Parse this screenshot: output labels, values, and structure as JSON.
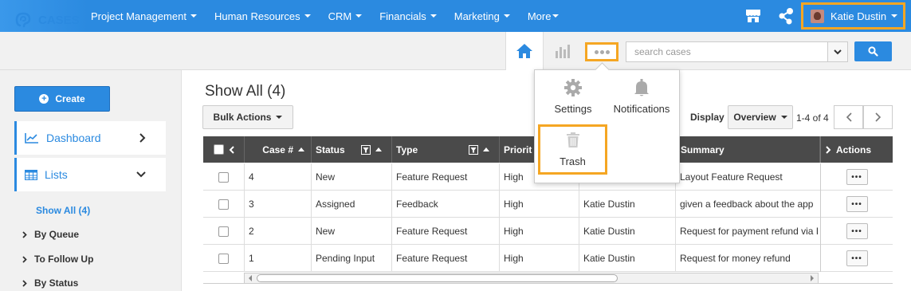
{
  "topnav": {
    "items": [
      "Project Management",
      "Human Resources",
      "CRM",
      "Financials",
      "Marketing",
      "More"
    ],
    "user_name": "Katie Dustin"
  },
  "module": {
    "title": "CASES",
    "search_placeholder": "search cases"
  },
  "more_menu": {
    "items": [
      "Settings",
      "Notifications",
      "Trash"
    ]
  },
  "sidebar": {
    "create_label": "Create",
    "dashboard_label": "Dashboard",
    "lists_label": "Lists",
    "show_all_label": "Show All (4)",
    "sub_items": [
      "By Queue",
      "To Follow Up",
      "By Status"
    ]
  },
  "main": {
    "title": "Show All (4)",
    "bulk_actions_label": "Bulk Actions",
    "display_label": "Display",
    "display_value": "Overview",
    "pager_text": "1-4 of 4"
  },
  "table": {
    "headers": [
      "Case #",
      "Status",
      "Type",
      "Priorit",
      "Summary",
      "Actions"
    ],
    "rows": [
      {
        "case": "4",
        "status": "New",
        "type": "Feature Request",
        "priority": "High",
        "assigned": "",
        "summary": "Layout Feature Request"
      },
      {
        "case": "3",
        "status": "Assigned",
        "type": "Feedback",
        "priority": "High",
        "assigned": "Katie Dustin",
        "summary": "given a feedback about the app"
      },
      {
        "case": "2",
        "status": "New",
        "type": "Feature Request",
        "priority": "High",
        "assigned": "Katie Dustin",
        "summary": "Request for payment refund via I"
      },
      {
        "case": "1",
        "status": "Pending Input",
        "type": "Feature Request",
        "priority": "High",
        "assigned": "Katie Dustin",
        "summary": "Request for money refund"
      }
    ],
    "action_glyph": "•••"
  },
  "colors": {
    "brand_blue": "#2b8ae0",
    "highlight_orange": "#f5a623",
    "header_dark": "#4a4a4a"
  }
}
